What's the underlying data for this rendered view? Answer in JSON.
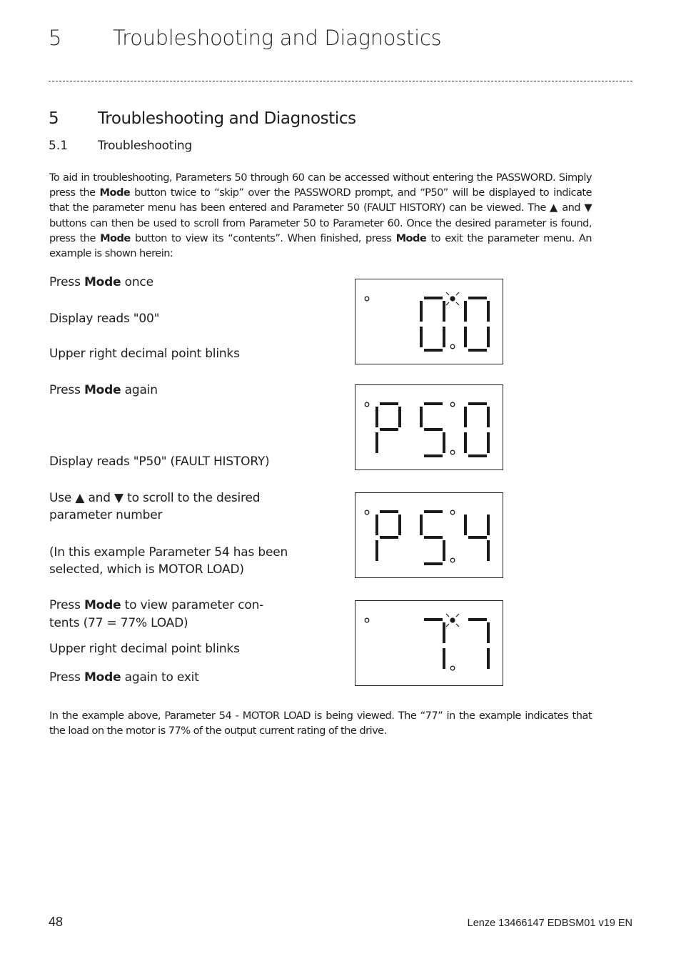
{
  "header": {
    "chapter_number": "5",
    "chapter_title": "Troubleshooting and Diagnostics"
  },
  "section": {
    "number": "5",
    "title": "Troubleshooting and Diagnostics",
    "subsection_number": "5.1",
    "subsection_title": "Troubleshooting"
  },
  "intro": {
    "parts": [
      {
        "t": "To aid in troubleshooting, Parameters 50 through 60 can be accessed without entering the PASSWORD. Simply press the "
      },
      {
        "t": "Mode",
        "b": true
      },
      {
        "t": " button twice to “skip” over the PASSWORD prompt, and “P50” will be displayed to indicate that the parameter menu has been entered and Parameter 50 (FAULT HISTORY) can be viewed. The ▲ and ▼ buttons can then be used to scroll from Parameter 50 to Parameter 60. Once the desired parameter is found, press the "
      },
      {
        "t": "Mode",
        "b": true
      },
      {
        "t": " button to view its “contents”. When finished, press "
      },
      {
        "t": "Mode",
        "b": true
      },
      {
        "t": " to exit the parameter menu. An example is shown herein:"
      }
    ]
  },
  "steps": [
    {
      "parts": [
        {
          "t": "Press "
        },
        {
          "t": "Mode",
          "b": true
        },
        {
          "t": " once"
        }
      ]
    },
    {
      "parts": [
        {
          "t": "Display reads \"00\""
        }
      ]
    },
    {
      "parts": [
        {
          "t": "Upper right decimal point blinks"
        }
      ]
    },
    {
      "parts": [
        {
          "t": "Press "
        },
        {
          "t": "Mode",
          "b": true
        },
        {
          "t": " again"
        }
      ]
    },
    {
      "parts": [
        {
          "t": "Display reads \"P50\" (FAULT HISTORY)"
        }
      ]
    },
    {
      "parts": [
        {
          "t": "Use ▲ and ▼ to scroll to the desired"
        }
      ]
    },
    {
      "parts": [
        {
          "t": "parameter number"
        }
      ]
    },
    {
      "parts": [
        {
          "t": "(In this example Parameter 54 has been"
        }
      ]
    },
    {
      "parts": [
        {
          "t": "selected, which is MOTOR LOAD)"
        }
      ]
    },
    {
      "parts": [
        {
          "t": "Press "
        },
        {
          "t": "Mode",
          "b": true
        },
        {
          "t": " to view parameter con-"
        }
      ]
    },
    {
      "parts": [
        {
          "t": "tents (77 = 77% LOAD)"
        }
      ]
    },
    {
      "parts": [
        {
          "t": "Upper right decimal point blinks"
        }
      ]
    },
    {
      "parts": [
        {
          "t": "Press "
        },
        {
          "t": "Mode",
          "b": true
        },
        {
          "t": " again to exit"
        }
      ]
    }
  ],
  "displays": [
    {
      "reading": "00",
      "digits": [
        "",
        "0",
        "0"
      ],
      "upper_point_blinking": true
    },
    {
      "reading": "P50",
      "digits": [
        "P",
        "5",
        "0"
      ],
      "upper_point_blinking": false
    },
    {
      "reading": "P54",
      "digits": [
        "P",
        "5",
        "4"
      ],
      "upper_point_blinking": false
    },
    {
      "reading": "77",
      "digits": [
        "",
        "7",
        "7"
      ],
      "upper_point_blinking": true
    }
  ],
  "outro": {
    "parts": [
      {
        "t": "In the example above, Parameter 54 - MOTOR LOAD is being viewed. The “77” in the example indicates that the load on the motor is 77% of the output current rating of the drive."
      }
    ]
  },
  "footer": {
    "page_number": "48",
    "document_id": "Lenze 13466147 EDBSM01 v19 EN"
  }
}
